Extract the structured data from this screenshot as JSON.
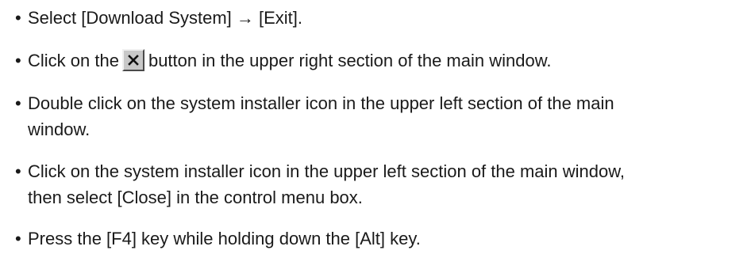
{
  "instructions": {
    "items": [
      {
        "bullet": "•",
        "text": "Select [Download System] → [Exit]."
      },
      {
        "bullet": "•",
        "before": "Click on the",
        "icon": "close-x-icon",
        "after": "button in the upper right section of the main window."
      },
      {
        "bullet": "•",
        "line1": "Double click on the system installer icon in the upper left section of the main",
        "line2": "window."
      },
      {
        "bullet": "•",
        "line1": "Click on the system installer icon in the upper left section of the main window,",
        "line2": "then select [Close] in the control menu box."
      },
      {
        "bullet": "•",
        "text": "Press the [F4] key while holding down the [Alt] key."
      }
    ]
  }
}
